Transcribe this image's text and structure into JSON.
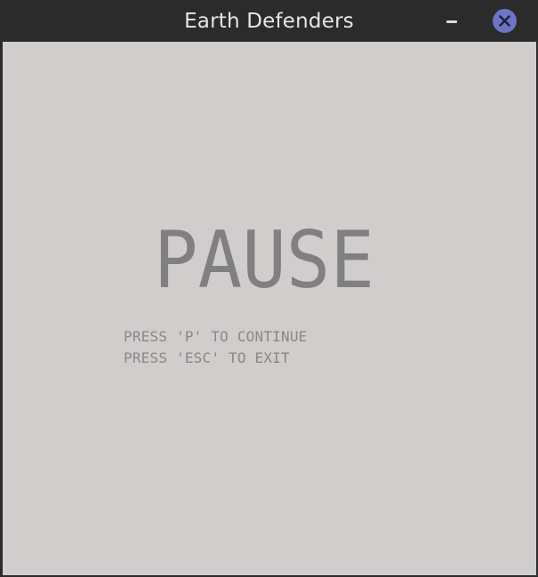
{
  "window": {
    "title": "Earth Defenders"
  },
  "pause_screen": {
    "heading": "PAUSE",
    "hints": [
      "PRESS 'P' TO CONTINUE",
      "PRESS 'ESC' TO EXIT"
    ]
  },
  "colors": {
    "titlebar": "#2b2b2b",
    "background": "#d2cdcd",
    "heading": "#808080",
    "hint_text": "#8a8787",
    "close_button": "#6e73c5"
  },
  "icons": {
    "minimize": "minimize-icon",
    "close": "close-icon"
  }
}
